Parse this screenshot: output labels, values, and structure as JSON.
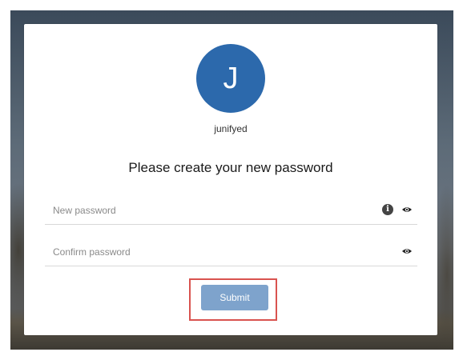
{
  "profile": {
    "avatar_initial": "J",
    "avatar_color": "#2c69ac",
    "username": "junifyed"
  },
  "form": {
    "heading": "Please create your new password",
    "new_password": {
      "placeholder": "New password",
      "value": "",
      "icons": [
        "info-icon",
        "eye-icon"
      ]
    },
    "confirm_password": {
      "placeholder": "Confirm password",
      "value": "",
      "icons": [
        "eye-icon"
      ]
    },
    "submit_label": "Submit",
    "submit_color": "#7ea3cc",
    "highlight_color": "#d9534f"
  }
}
